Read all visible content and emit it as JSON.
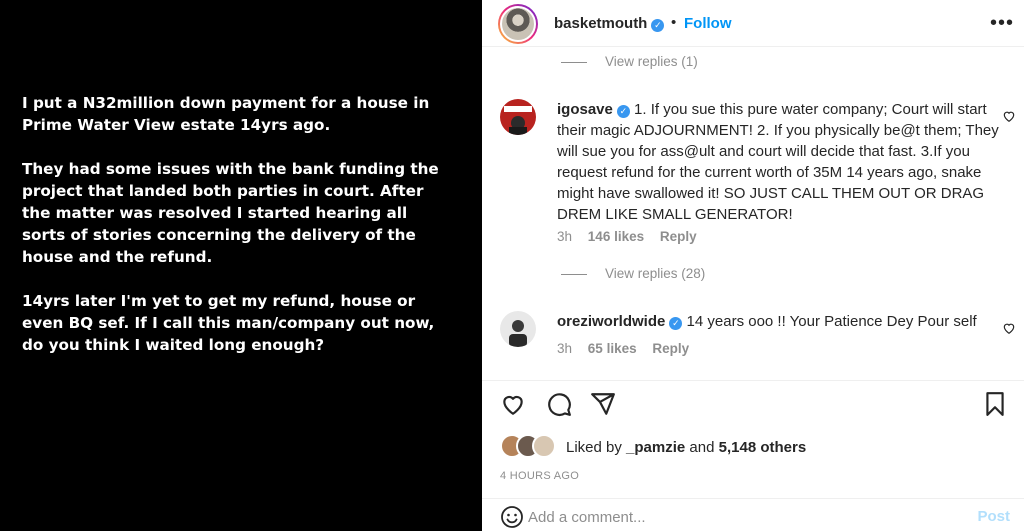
{
  "media": {
    "paragraphs": [
      "I put a N32million down payment for a house in\nPrime Water View estate 14yrs ago.",
      "They had some issues with the bank funding the\nproject that landed both parties in court. After\nthe matter was resolved I started hearing all\nsorts of stories concerning the delivery of the\nhouse and the refund.",
      "14yrs later I'm yet to get my refund, house or\neven BQ sef. If I call this man/company out now,\ndo you think I waited long enough?"
    ]
  },
  "header": {
    "username": "basketmouth",
    "dot": "•",
    "follow_label": "Follow",
    "more_icon": "more-horizontal-icon"
  },
  "comments": {
    "view_replies_top": "View replies (1)",
    "items": [
      {
        "username": "igosave",
        "text": "1. If you sue this pure water company; Court will start their magic ADJOURNMENT! 2. If you physically be@t them; They will sue you for ass@ult and court will decide that fast. 3.If you request refund for the current worth of 35M 14 years ago, snake might have swallowed it! SO JUST CALL THEM OUT OR DRAG DREM LIKE SMALL GENERATOR!",
        "time": "3h",
        "likes": "146 likes",
        "reply": "Reply",
        "view_replies": "View replies (28)"
      },
      {
        "username": "oreziworldwide",
        "text": "14 years ooo !! Your Patience Dey Pour self",
        "time": "3h",
        "likes": "65 likes",
        "reply": "Reply"
      }
    ]
  },
  "actions": {
    "icons": [
      "heart-icon",
      "comment-icon",
      "share-icon",
      "bookmark-icon"
    ]
  },
  "liked": {
    "prefix": "Liked by ",
    "user": "_pamzie",
    "middle": " and ",
    "others": "5,148 others"
  },
  "timestamp": "4 HOURS AGO",
  "add_comment": {
    "placeholder": "Add a comment...",
    "post_label": "Post"
  },
  "colors": {
    "accent": "#0095f6",
    "verified": "#3897f0",
    "muted": "#8e8e8e",
    "post_disabled": "#b2dffc"
  }
}
